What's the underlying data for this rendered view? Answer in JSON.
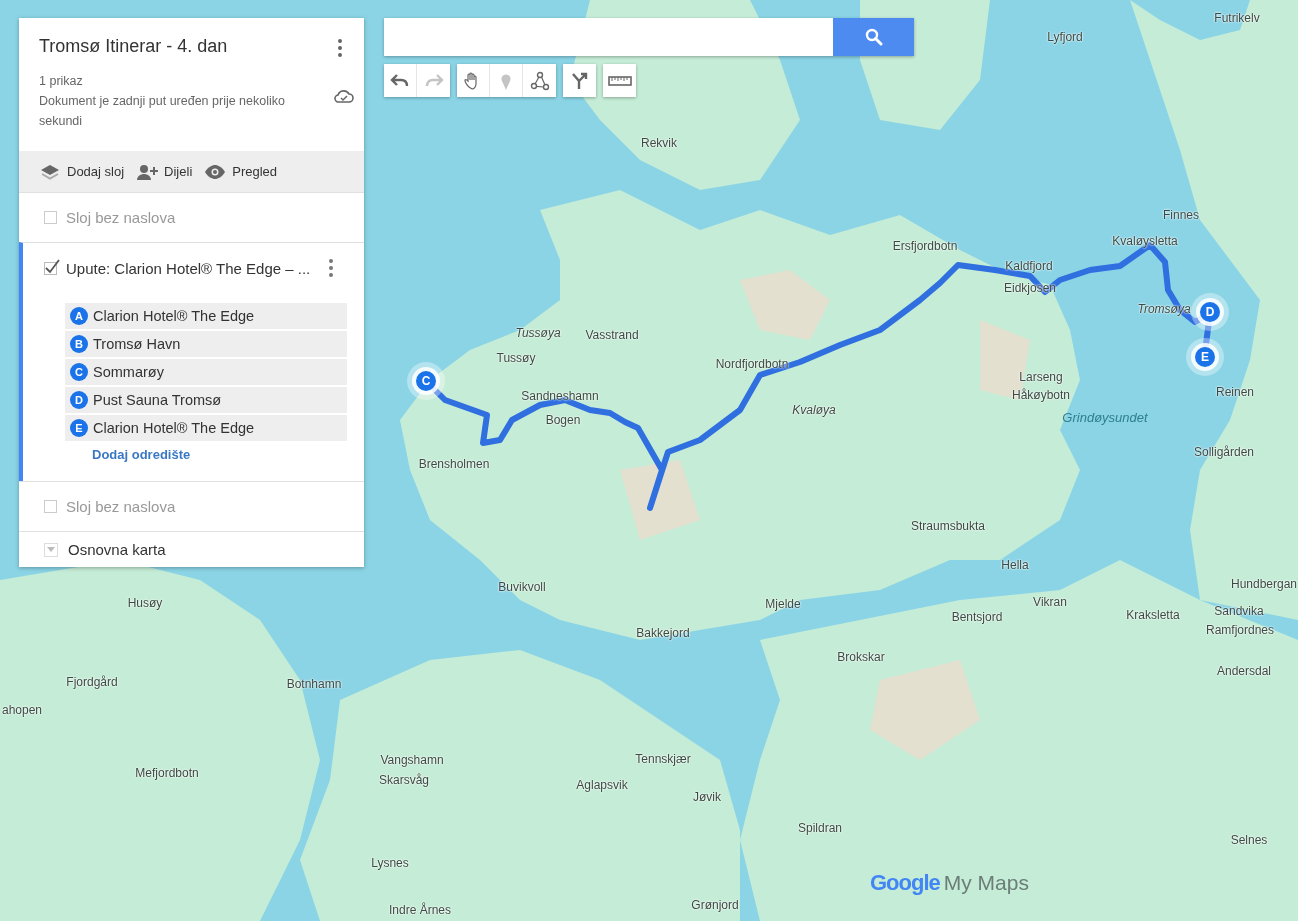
{
  "map_title": {
    "title": "Tromsø Itinerar - 4. dan",
    "views": "1 prikaz",
    "saved_note": "Dokument je zadnji put uređen prije nekoliko sekundi"
  },
  "actions": [
    {
      "kind": "layer",
      "label": "Dodaj sloj"
    },
    {
      "kind": "share",
      "label": "Dijeli"
    },
    {
      "kind": "preview",
      "label": "Pregled"
    }
  ],
  "layers": [
    {
      "kind": "plain",
      "title": "Sloj bez naslova",
      "checked": false,
      "selected": false
    },
    {
      "kind": "directions",
      "title": "Upute: Clarion Hotel® The Edge – ...",
      "checked": true,
      "selected": true,
      "stops": [
        {
          "letter": "A",
          "name": "Clarion Hotel® The Edge"
        },
        {
          "letter": "B",
          "name": "Tromsø Havn"
        },
        {
          "letter": "C",
          "name": "Sommarøy"
        },
        {
          "letter": "D",
          "name": "Pust Sauna Tromsø"
        },
        {
          "letter": "E",
          "name": "Clarion Hotel® The Edge"
        }
      ],
      "add_link": "Dodaj odredište"
    },
    {
      "kind": "plain",
      "title": "Sloj bez naslova",
      "checked": false,
      "selected": false
    },
    {
      "kind": "base",
      "title": "Osnovna karta"
    }
  ],
  "tools": [
    {
      "kind": "undo",
      "disabled": false
    },
    {
      "kind": "redo",
      "disabled": true
    },
    {
      "kind": "hand",
      "disabled": false
    },
    {
      "kind": "marker",
      "disabled": true
    },
    {
      "kind": "line",
      "disabled": false
    },
    {
      "kind": "directions",
      "disabled": false
    },
    {
      "kind": "ruler",
      "disabled": false
    }
  ],
  "map": {
    "markers": [
      {
        "letter": "C"
      },
      {
        "letter": "D"
      },
      {
        "letter": "E"
      }
    ],
    "place_labels": [
      "Futrikelv",
      "Lyfjord",
      "Rekvik",
      "Finnes",
      "Ersfjordbotn",
      "Kvaløysletta",
      "Kaldfjord",
      "Eidkjosen",
      "Tromsøya",
      "Tussøya",
      "Vasstrand",
      "Tussøy",
      "Nordfjordbotn",
      "Larseng",
      "Kvaløya",
      "Håkøybotn",
      "Grindøysundet",
      "Reinen",
      "Sandneshamn",
      "Bogen",
      "Solligården",
      "Brensholmen",
      "Straumsbukta",
      "Hella",
      "Buvikvoll",
      "Husøy",
      "Mjelde",
      "Vikran",
      "Bentsjord",
      "Kraksletta",
      "Hundbergan",
      "Sandvika",
      "Ramfjordnes",
      "Andersdal",
      "Bakkejord",
      "Brokskar",
      "Fjordgård",
      "Botnhamn",
      "ahopen",
      "Vangshamn",
      "Skarsvåg",
      "Mefjordbotn",
      "Tennskjær",
      "Aglapsvik",
      "Jøvik",
      "Spildran",
      "Selnes",
      "Lysnes",
      "Indre Årnes",
      "Grønjord"
    ],
    "logo": {
      "brand": "Google",
      "product": "My Maps"
    }
  }
}
